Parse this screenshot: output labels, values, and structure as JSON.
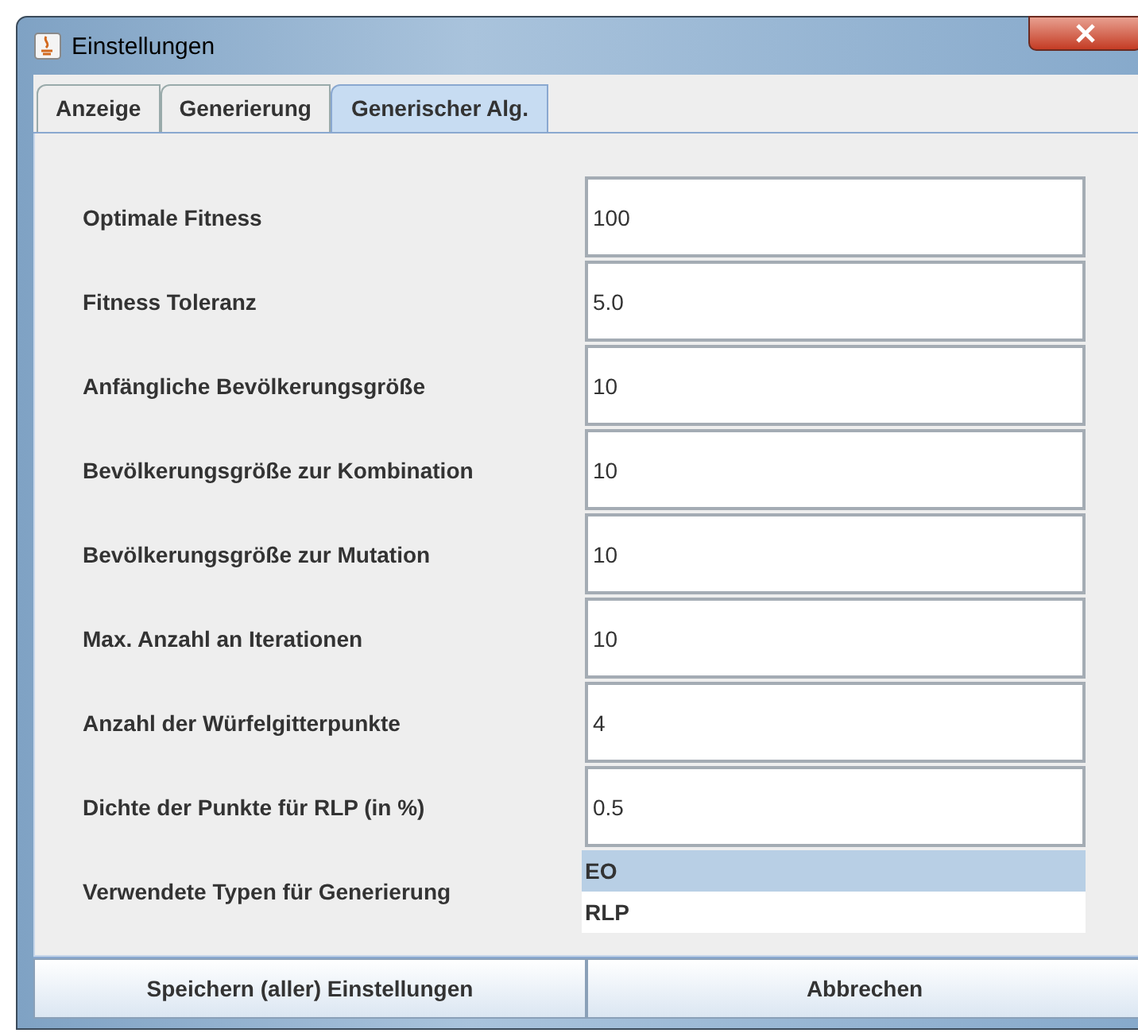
{
  "window": {
    "title": "Einstellungen"
  },
  "tabs": [
    {
      "label": "Anzeige",
      "selected": false
    },
    {
      "label": "Generierung",
      "selected": false
    },
    {
      "label": "Generischer Alg.",
      "selected": true
    }
  ],
  "fields": [
    {
      "label": "Optimale Fitness",
      "value": "100"
    },
    {
      "label": "Fitness Toleranz",
      "value": "5.0"
    },
    {
      "label": "Anfängliche Bevölkerungsgröße",
      "value": "10"
    },
    {
      "label": "Bevölkerungsgröße zur Kombination",
      "value": "10"
    },
    {
      "label": "Bevölkerungsgröße zur Mutation",
      "value": "10"
    },
    {
      "label": "Max. Anzahl an Iterationen",
      "value": "10"
    },
    {
      "label": "Anzahl der Würfelgitterpunkte",
      "value": "4"
    },
    {
      "label": "Dichte der Punkte für RLP (in %)",
      "value": "0.5"
    }
  ],
  "types": {
    "label": "Verwendete Typen für Generierung",
    "items": [
      {
        "label": "EO",
        "selected": true
      },
      {
        "label": "RLP",
        "selected": false
      }
    ]
  },
  "buttons": [
    "Speichern (aller) Einstellungen",
    "Abbrechen"
  ]
}
